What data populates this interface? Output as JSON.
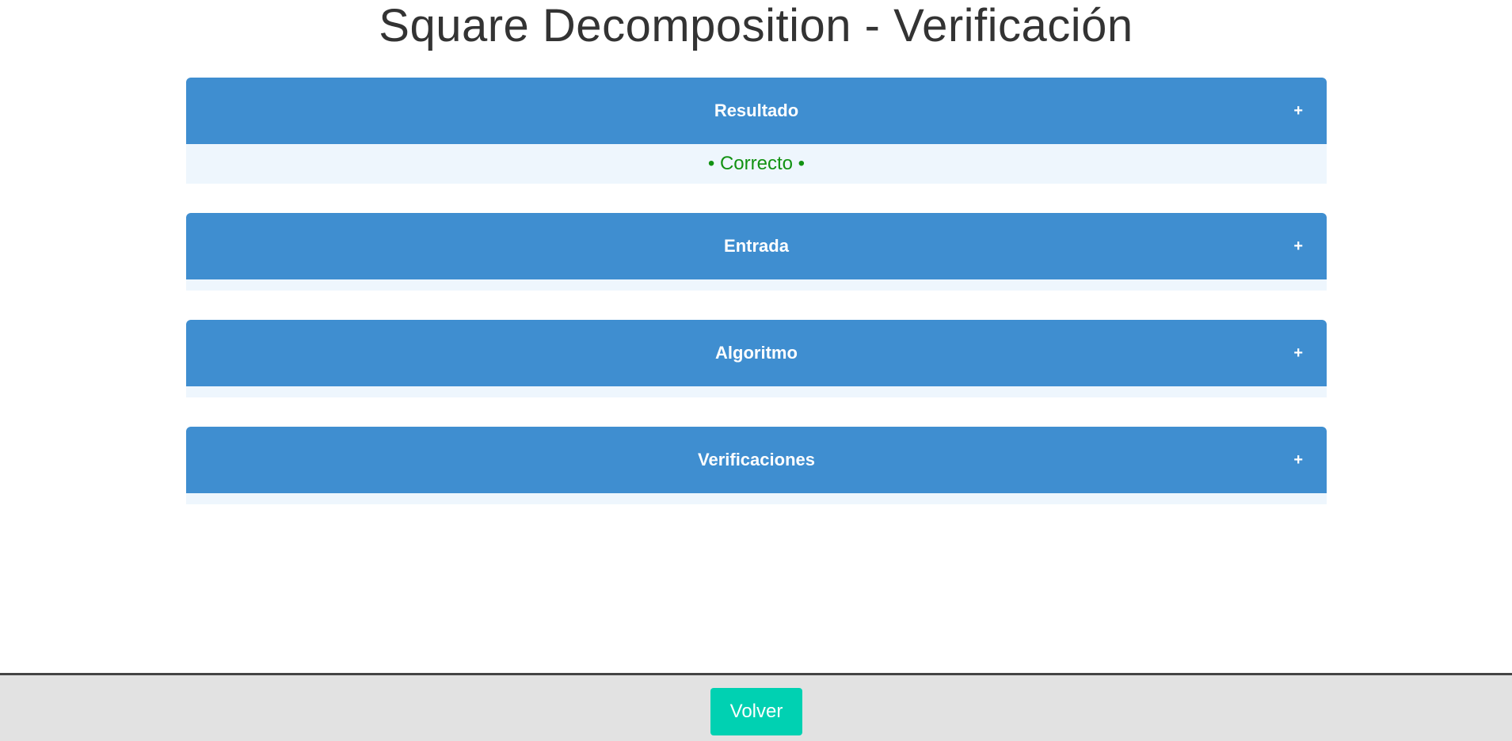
{
  "page": {
    "title": "Square Decomposition - Verificación"
  },
  "sections": [
    {
      "label": "Resultado",
      "toggle": "+",
      "content": "• Correcto •"
    },
    {
      "label": "Entrada",
      "toggle": "+"
    },
    {
      "label": "Algoritmo",
      "toggle": "+"
    },
    {
      "label": "Verificaciones",
      "toggle": "+"
    }
  ],
  "footer": {
    "back_label": "Volver"
  },
  "colors": {
    "header_bg": "#3f8ed0",
    "body_bg": "#eef6fd",
    "success_text": "#129212",
    "button_bg": "#00d1b2",
    "footer_bg": "#e2e2e2"
  }
}
